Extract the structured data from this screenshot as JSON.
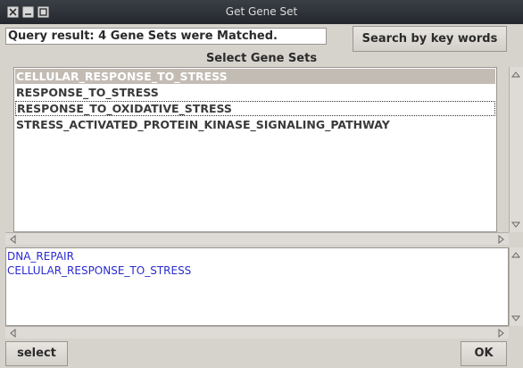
{
  "window": {
    "title": "Get Gene Set"
  },
  "query": {
    "result_text": "Query result: 4 Gene Sets were Matched."
  },
  "buttons": {
    "search_label": "Search by key words",
    "select_label": "select",
    "ok_label": "OK"
  },
  "gene_sets": {
    "heading": "Select Gene Sets",
    "items": [
      {
        "label": "CELLULAR_RESPONSE_TO_STRESS",
        "state": "selected"
      },
      {
        "label": "RESPONSE_TO_STRESS",
        "state": "normal"
      },
      {
        "label": "RESPONSE_TO_OXIDATIVE_STRESS",
        "state": "focused"
      },
      {
        "label": "STRESS_ACTIVATED_PROTEIN_KINASE_SIGNALING_PATHWAY",
        "state": "normal"
      }
    ]
  },
  "selected_sets": {
    "items": [
      {
        "label": "DNA_REPAIR"
      },
      {
        "label": "CELLULAR_RESPONSE_TO_STRESS"
      }
    ]
  },
  "colors": {
    "selected_bg": "#c2bcb4",
    "selected_list_text": "#2a2ad0",
    "panel_bg": "#d6d2cc"
  }
}
